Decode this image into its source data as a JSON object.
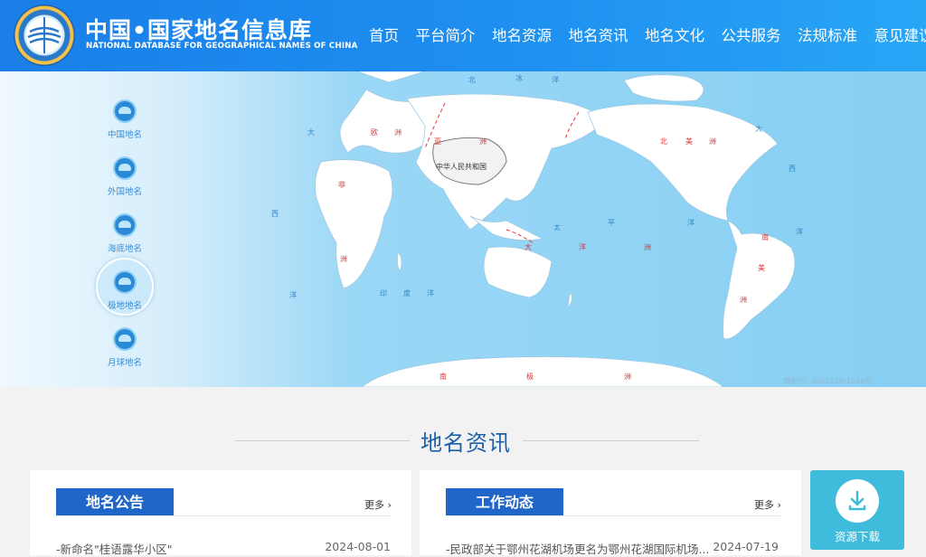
{
  "header": {
    "title": "中国•国家地名信息库",
    "subtitle": "NATIONAL DATABASE FOR GEOGRAPHICAL NAMES OF CHINA",
    "logo_icon": "globe-emblem-icon"
  },
  "nav": [
    "首页",
    "平台简介",
    "地名资源",
    "地名资讯",
    "地名文化",
    "公共服务",
    "法规标准",
    "意见建议"
  ],
  "sidebar": {
    "items": [
      {
        "label": "中国地名",
        "icon": "china-map-icon"
      },
      {
        "label": "外国地名",
        "icon": "globe-icon"
      },
      {
        "label": "海底地名",
        "icon": "seafloor-icon"
      },
      {
        "label": "极地地名",
        "icon": "polar-icon",
        "active": true
      },
      {
        "label": "月球地名",
        "icon": "moon-icon"
      }
    ]
  },
  "map": {
    "labels": {
      "china": "中华人民共和国",
      "europe": [
        "欧",
        "洲"
      ],
      "asia": [
        "亚",
        "洲"
      ],
      "africa": [
        "非",
        "洲"
      ],
      "north_america": [
        "北",
        "美",
        "洲"
      ],
      "south_america": [
        "南",
        "美",
        "洲"
      ],
      "oceania": [
        "大",
        "洋",
        "洲"
      ],
      "antarctica": [
        "南",
        "极",
        "洲"
      ],
      "pacific": [
        "太",
        "平",
        "洋"
      ],
      "indian": [
        "印",
        "度",
        "洋"
      ],
      "atlantic_w": [
        "大",
        "西",
        "洋"
      ],
      "atlantic_e": [
        "大",
        "西",
        "洋"
      ],
      "arctic": [
        "北",
        "冰",
        "洋"
      ]
    },
    "approval": "审图号：GS(2016)1569号"
  },
  "news_section": {
    "title": "地名资讯",
    "announcements": {
      "heading": "地名公告",
      "more": "更多",
      "items": [
        {
          "title": "-新命名\"桂语露华小区\"",
          "date": "2024-08-01"
        }
      ]
    },
    "work": {
      "heading": "工作动态",
      "more": "更多",
      "items": [
        {
          "title": "-民政部关于鄂州花湖机场更名为鄂州花湖国际机场...",
          "date": "2024-07-19"
        }
      ]
    },
    "download": {
      "label": "资源下载",
      "icon": "download-icon"
    }
  },
  "colors": {
    "header": "#1a7fe8",
    "accent": "#1f66c8",
    "download": "#3fbcdc",
    "ocean": "#86cff3"
  }
}
